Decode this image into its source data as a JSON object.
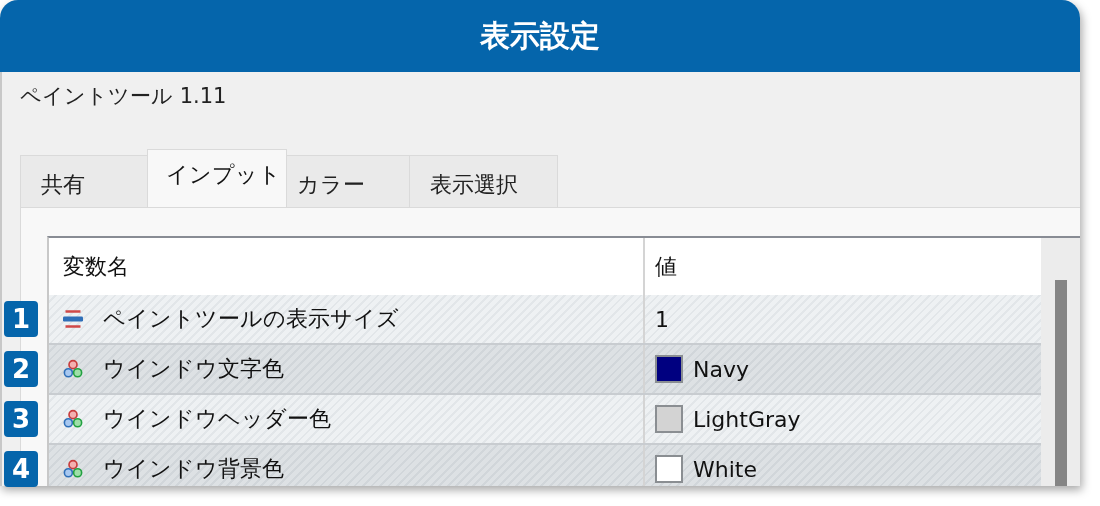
{
  "window": {
    "title": "表示設定"
  },
  "dialog_name": "ペイントツール 1.11",
  "tabs": [
    {
      "label": "共有",
      "selected": false
    },
    {
      "label": "インプット",
      "selected": true
    },
    {
      "label": "カラー",
      "selected": false
    },
    {
      "label": "表示選択",
      "selected": false
    }
  ],
  "table": {
    "columns": [
      "変数名",
      "値"
    ],
    "rows": [
      {
        "badge": "1",
        "kind": "number",
        "name": "ペイントツールの表示サイズ",
        "value": "1"
      },
      {
        "badge": "2",
        "kind": "color",
        "name": "ウインドウ文字色",
        "value": "Navy",
        "color": "#000080"
      },
      {
        "badge": "3",
        "kind": "color",
        "name": "ウインドウヘッダー色",
        "value": "LightGray",
        "color": "#d3d3d3"
      },
      {
        "badge": "4",
        "kind": "color",
        "name": "ウインドウ背景色",
        "value": "White",
        "color": "#ffffff"
      }
    ]
  }
}
